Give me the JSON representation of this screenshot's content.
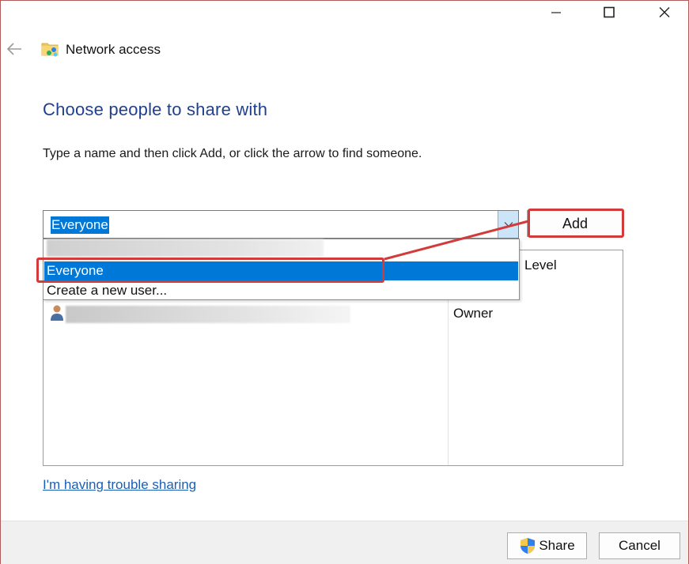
{
  "window": {
    "title": "Network access",
    "minimize_icon": "minimize-icon",
    "maximize_icon": "maximize-icon",
    "close_icon": "close-icon"
  },
  "nav": {
    "back_icon": "arrow-left-icon",
    "app_icon": "network-folder-icon"
  },
  "page": {
    "heading": "Choose people to share with",
    "instructions": "Type a name and then click Add, or click the arrow to find someone."
  },
  "name_combo": {
    "value": "Everyone",
    "arrow_icon": "chevron-down-icon"
  },
  "add_button": {
    "label": "Add"
  },
  "dropdown": {
    "items": [
      {
        "label": "Everyone",
        "selected": true
      },
      {
        "label": "Create a new user...",
        "selected": false
      }
    ]
  },
  "people_list": {
    "permission_header": "Level",
    "rows": [
      {
        "icon": "user-icon",
        "permission": "Owner"
      }
    ]
  },
  "trouble_link": "I'm having trouble sharing",
  "footer": {
    "share_label": "Share",
    "share_icon": "uac-shield-icon",
    "cancel_label": "Cancel"
  },
  "colors": {
    "heading": "#1f3f8f",
    "selection": "#0078d7",
    "highlight_annotation": "#d33a3a",
    "link": "#1a5fb4"
  }
}
